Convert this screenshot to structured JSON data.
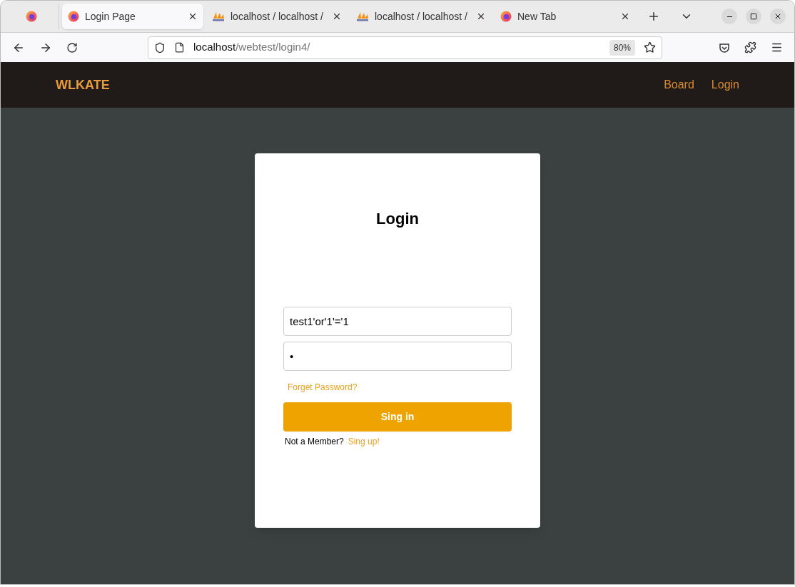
{
  "browser": {
    "tabs": [
      {
        "label": "Login Page",
        "selected": true,
        "kind": "firefox"
      },
      {
        "label": "localhost / localhost /",
        "selected": false,
        "kind": "pma"
      },
      {
        "label": "localhost / localhost /",
        "selected": false,
        "kind": "pma"
      },
      {
        "label": "New Tab",
        "selected": false,
        "kind": "firefox"
      }
    ],
    "url": {
      "host": "localhost",
      "path": "/webtest/login4/"
    },
    "zoom": "80%"
  },
  "navbar": {
    "brand": "WLKATE",
    "links": [
      "Board",
      "Login"
    ]
  },
  "login": {
    "title": "Login",
    "username": "test1'or'1'='1",
    "password": "•",
    "forgot": "Forget Password?",
    "submit": "Sing in",
    "signup_prompt": "Not a Member?",
    "signup_link": "Sing up!"
  }
}
